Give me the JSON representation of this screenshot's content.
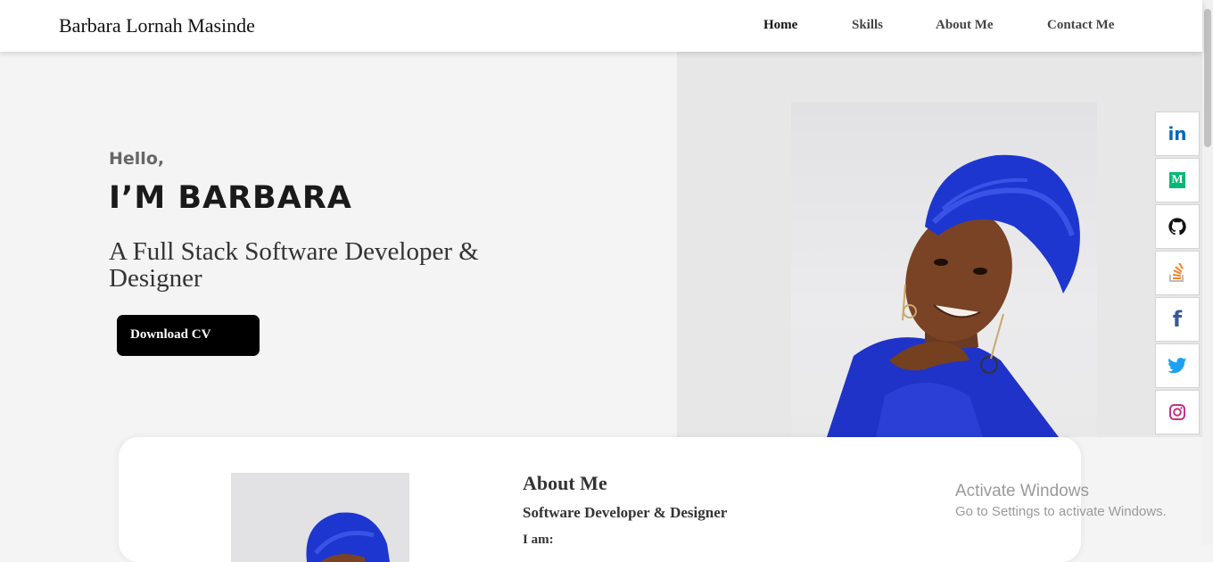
{
  "nav": {
    "brand": "Barbara Lornah Masinde",
    "links": [
      {
        "label": "Home"
      },
      {
        "label": "Skills"
      },
      {
        "label": "About Me"
      },
      {
        "label": "Contact Me"
      }
    ]
  },
  "hero": {
    "greeting": "Hello,",
    "name": "I’M BARBARA",
    "tagline": "A Full Stack Software Developer & Designer",
    "cta_label": "Download CV"
  },
  "social": [
    {
      "icon": "linkedin-icon",
      "glyph": "in",
      "color": "#0a66c2"
    },
    {
      "icon": "medium-icon",
      "glyph": "M",
      "color": "#02b875"
    },
    {
      "icon": "github-icon",
      "glyph": "",
      "color": "#111111"
    },
    {
      "icon": "stackoverflow-icon",
      "glyph": "",
      "color": "#f48024"
    },
    {
      "icon": "facebook-icon",
      "glyph": "f",
      "color": "#3b5998"
    },
    {
      "icon": "twitter-icon",
      "glyph": "",
      "color": "#1da1f2"
    },
    {
      "icon": "instagram-icon",
      "glyph": "",
      "color": "#c13584"
    }
  ],
  "about": {
    "title": "About Me",
    "subtitle": "Software Developer & Designer",
    "iam_label": "I am:"
  },
  "watermark": {
    "title": "Activate Windows",
    "subtitle": "Go to Settings to activate Windows."
  }
}
